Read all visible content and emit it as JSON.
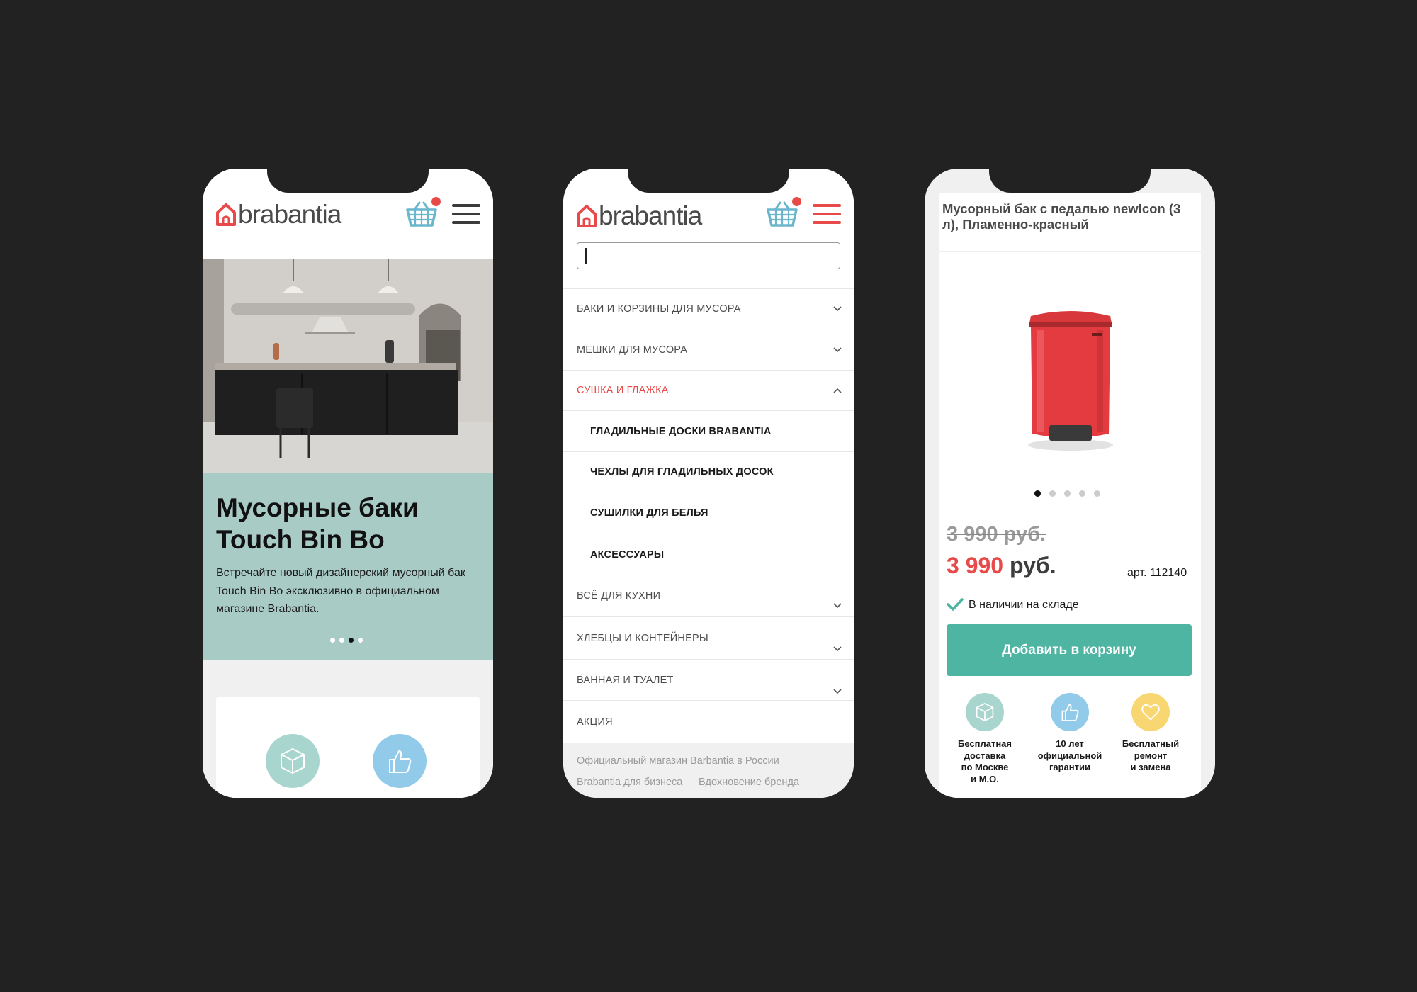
{
  "brand": {
    "logo_text": "brabantia",
    "accent": "#e84a4a",
    "teal": "#4fb5a3",
    "hero_bg": "#a9cbc6"
  },
  "home": {
    "hero": {
      "title": "Мусорные баки Touch Bin Bo",
      "text": "Встречайте новый дизайнерский мусорный бак Touch Bin Bo эксклюзивно в официальном магазине Brabantia.",
      "slides_count": 4,
      "active_slide": 3
    },
    "benefits": [
      {
        "icon": "box-icon",
        "color": "#a9d5cf"
      },
      {
        "icon": "thumbs-up-icon",
        "color": "#92cbe9"
      }
    ]
  },
  "menu_page": {
    "search": {
      "value": "",
      "placeholder": ""
    },
    "items": [
      {
        "label": "БАКИ И КОРЗИНЫ ДЛЯ МУСОРА",
        "level": 1,
        "chevron": "down"
      },
      {
        "label": "МЕШКИ ДЛЯ МУСОРА",
        "level": 1,
        "chevron": "down"
      },
      {
        "label": "СУШКА И ГЛАЖКА",
        "level": 1,
        "chevron": "up",
        "active": true
      },
      {
        "label": "ГЛАДИЛЬНЫЕ ДОСКИ BRABANTIA",
        "level": 2
      },
      {
        "label": "ЧЕХЛЫ ДЛЯ ГЛАДИЛЬНЫХ ДОСОК",
        "level": 2
      },
      {
        "label": "СУШИЛКИ ДЛЯ БЕЛЬЯ",
        "level": 2
      },
      {
        "label": "АКСЕССУАРЫ",
        "level": 2
      },
      {
        "label": "ВСЁ ДЛЯ КУХНИ",
        "level": 1,
        "chevron": "down"
      },
      {
        "label": "ХЛЕБЦЫ И КОНТЕЙНЕРЫ",
        "level": 1,
        "chevron": "down"
      },
      {
        "label": "ВАННАЯ И ТУАЛЕТ",
        "level": 1,
        "chevron": "down"
      },
      {
        "label": "АКЦИЯ",
        "level": 1
      }
    ],
    "footer": {
      "official": "Официальный магазин Barbantia в России",
      "business": "Brabantia для бизнеса",
      "inspiration": "Вдохновение бренда"
    }
  },
  "product": {
    "title": "Мусорный бак с педалью newIcon (3 л), Пламенно-красный",
    "image_slides": 5,
    "active_image": 1,
    "old_price": "3 990 руб.",
    "new_price": "3 990",
    "currency": "руб.",
    "article": "арт. 112140",
    "stock": "В наличии на складе",
    "add_to_cart": "Добавить в корзину",
    "product_color": "#e33b3f",
    "features": [
      {
        "icon": "box-icon",
        "color": "#a9d5cf",
        "label": "Бесплатная\nдоставка\nпо Москве\nи М.О."
      },
      {
        "icon": "thumbs-up-icon",
        "color": "#92cbe9",
        "label": "10 лет\nофициальной\nгарантии"
      },
      {
        "icon": "heart-icon",
        "color": "#f8d773",
        "label": "Бесплатный\nремонт\nи замена"
      }
    ]
  }
}
